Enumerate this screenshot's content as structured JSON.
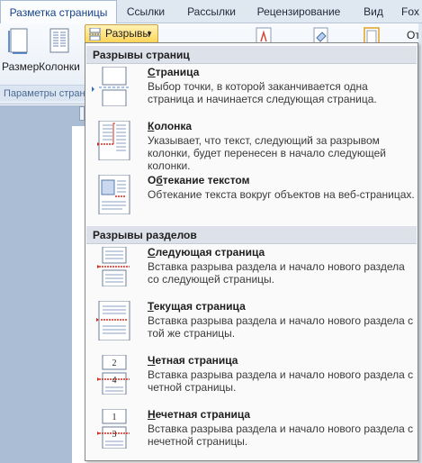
{
  "tabs": [
    {
      "label": "Разметка страницы",
      "active": true
    },
    {
      "label": "Ссылки",
      "active": false
    },
    {
      "label": "Рассылки",
      "active": false
    },
    {
      "label": "Рецензирование",
      "active": false
    },
    {
      "label": "Вид",
      "active": false
    },
    {
      "label": "Fox",
      "active": false
    }
  ],
  "ribbon": {
    "size_label": "Размер",
    "columns_label": "Колонки",
    "breaks_label": "Разрывы",
    "group_label": "Параметры страни",
    "right_partial": "Отс"
  },
  "menu": {
    "page_breaks_header": "Разрывы страниц",
    "section_breaks_header": "Разрывы разделов",
    "items": [
      {
        "title_prefix": "",
        "title_key": "С",
        "title_rest": "траница",
        "desc": "Выбор точки, в которой заканчивается одна страница и начинается следующая страница.",
        "icon": "page-break-icon"
      },
      {
        "title_prefix": "",
        "title_key": "К",
        "title_rest": "олонка",
        "desc": "Указывает, что текст, следующий за разрывом колонки, будет перенесен в начало следующей колонки.",
        "icon": "column-break-icon"
      },
      {
        "title_prefix": "О",
        "title_key": "б",
        "title_rest": "текание текстом",
        "desc": "Обтекание текста вокруг объектов на веб-страницах.",
        "icon": "text-wrapping-break-icon"
      },
      {
        "title_prefix": "",
        "title_key": "С",
        "title_rest": "ледующая страница",
        "desc": "Вставка разрыва раздела и начало нового раздела со следующей страницы.",
        "icon": "next-page-section-icon"
      },
      {
        "title_prefix": "",
        "title_key": "Т",
        "title_rest": "екущая страница",
        "desc": "Вставка разрыва раздела и начало нового раздела с той же страницы.",
        "icon": "continuous-section-icon"
      },
      {
        "title_prefix": "",
        "title_key": "Ч",
        "title_rest": "етная страница",
        "desc": "Вставка разрыва раздела и начало нового раздела с четной страницы.",
        "icon": "even-page-section-icon",
        "badge_top": "2",
        "badge_bottom": "4"
      },
      {
        "title_prefix": "",
        "title_key": "Н",
        "title_rest": "ечетная страница",
        "desc": "Вставка разрыва раздела и начало нового раздела с нечетной страницы.",
        "icon": "odd-page-section-icon",
        "badge_top": "1",
        "badge_bottom": "3"
      }
    ]
  },
  "colors": {
    "accent": "#ffd557",
    "break_red": "#d42a1e",
    "page_blue": "#5b8bd0"
  }
}
